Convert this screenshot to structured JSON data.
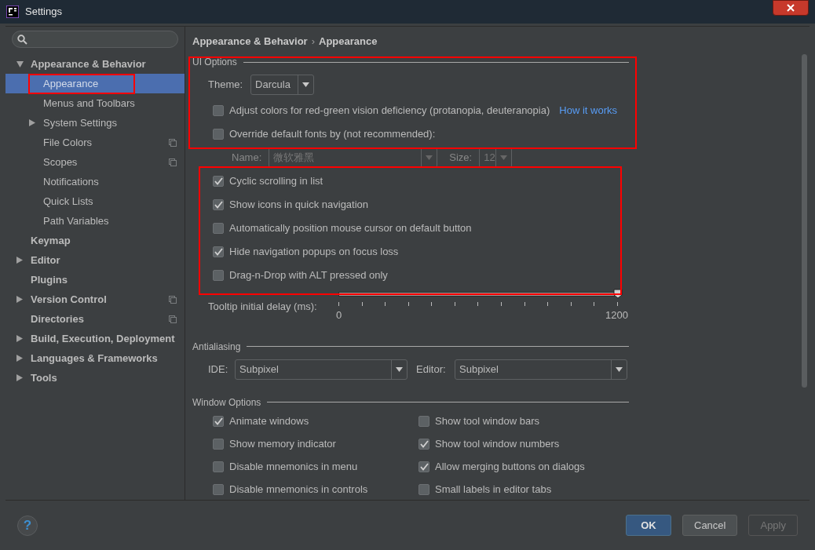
{
  "window": {
    "title": "Settings"
  },
  "sidebar": {
    "items": [
      {
        "label": "Appearance & Behavior",
        "selected": false,
        "expanded": true,
        "project_scoped": false,
        "children": [
          {
            "label": "Appearance",
            "selected": true,
            "project_scoped": false
          },
          {
            "label": "Menus and Toolbars",
            "selected": false,
            "project_scoped": false
          },
          {
            "label": "System Settings",
            "selected": false,
            "expanded": false,
            "project_scoped": false
          },
          {
            "label": "File Colors",
            "selected": false,
            "project_scoped": true
          },
          {
            "label": "Scopes",
            "selected": false,
            "project_scoped": true
          },
          {
            "label": "Notifications",
            "selected": false,
            "project_scoped": false
          },
          {
            "label": "Quick Lists",
            "selected": false,
            "project_scoped": false
          },
          {
            "label": "Path Variables",
            "selected": false,
            "project_scoped": false
          }
        ]
      },
      {
        "label": "Keymap",
        "selected": false,
        "project_scoped": false
      },
      {
        "label": "Editor",
        "selected": false,
        "expanded": false,
        "project_scoped": false
      },
      {
        "label": "Plugins",
        "selected": false,
        "project_scoped": false
      },
      {
        "label": "Version Control",
        "selected": false,
        "expanded": false,
        "project_scoped": true
      },
      {
        "label": "Directories",
        "selected": false,
        "project_scoped": true
      },
      {
        "label": "Build, Execution, Deployment",
        "selected": false,
        "expanded": false,
        "project_scoped": false
      },
      {
        "label": "Languages & Frameworks",
        "selected": false,
        "expanded": false,
        "project_scoped": false
      },
      {
        "label": "Tools",
        "selected": false,
        "expanded": false,
        "project_scoped": false
      }
    ]
  },
  "breadcrumb": {
    "parts": [
      "Appearance & Behavior",
      "Appearance"
    ],
    "separator": "›"
  },
  "ui_options": {
    "title": "UI Options",
    "theme": {
      "label": "Theme:",
      "value": "Darcula"
    },
    "checkboxes": [
      {
        "label": "Adjust colors for red-green vision deficiency (protanopia, deuteranopia)",
        "checked": false,
        "link": "How it works"
      },
      {
        "label": "Override default fonts by (not recommended):",
        "checked": false
      }
    ],
    "font": {
      "name_label": "Name:",
      "name_value": "微软雅黑",
      "size_label": "Size:",
      "size_value": "12",
      "disabled": true
    },
    "options": [
      {
        "label": "Cyclic scrolling in list",
        "checked": true
      },
      {
        "label": "Show icons in quick navigation",
        "checked": true
      },
      {
        "label": "Automatically position mouse cursor on default button",
        "checked": false
      },
      {
        "label": "Hide navigation popups on focus loss",
        "checked": true
      },
      {
        "label": "Drag-n-Drop with ALT pressed only",
        "checked": false
      }
    ],
    "tooltip_delay": {
      "label": "Tooltip initial delay (ms):",
      "level": 1,
      "min": "0",
      "max": "1200"
    }
  },
  "antialiasing": {
    "title": "Antialiasing",
    "ide": {
      "label": "IDE:",
      "value": "Subpixel"
    },
    "editor": {
      "label": "Editor:",
      "value": "Subpixel"
    }
  },
  "window_options": {
    "title": "Window Options",
    "checkboxes": [
      {
        "label": "Animate windows",
        "checked": true
      },
      {
        "label": "Show tool window bars",
        "checked": false
      },
      {
        "label": "Show memory indicator",
        "checked": false
      },
      {
        "label": "Show tool window numbers",
        "checked": true
      },
      {
        "label": "Disable mnemonics in menu",
        "checked": false
      },
      {
        "label": "Allow merging buttons on dialogs",
        "checked": true
      },
      {
        "label": "Disable mnemonics in controls",
        "checked": false
      },
      {
        "label": "Small labels in editor tabs",
        "checked": false
      }
    ]
  },
  "footer": {
    "help": "?",
    "buttons": [
      {
        "label": "OK",
        "kind": "default",
        "disabled": false
      },
      {
        "label": "Cancel",
        "kind": "normal",
        "disabled": false
      },
      {
        "label": "Apply",
        "kind": "normal",
        "disabled": true
      }
    ]
  }
}
